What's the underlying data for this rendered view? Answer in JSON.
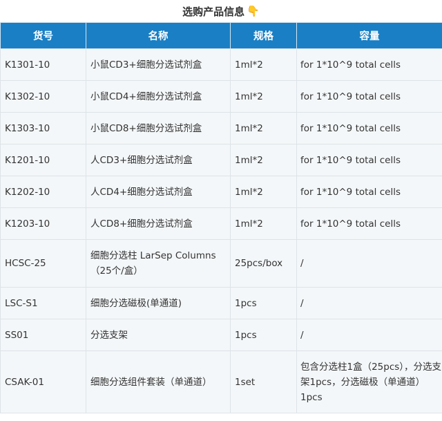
{
  "header": {
    "title": "选购产品信息",
    "icon": "pointing-hand-icon",
    "icon_color": "#f0b400"
  },
  "table": {
    "header_bg": "#1a7fc4",
    "columns": [
      "货号",
      "名称",
      "规格",
      "容量"
    ],
    "rows": [
      {
        "sku": "K1301-10",
        "name": "小鼠CD3+细胞分选试剂盒",
        "spec": "1ml*2",
        "capacity": "for 1*10^9 total cells"
      },
      {
        "sku": "K1302-10",
        "name": "小鼠CD4+细胞分选试剂盒",
        "spec": "1ml*2",
        "capacity": "for 1*10^9 total cells"
      },
      {
        "sku": "K1303-10",
        "name": "小鼠CD8+细胞分选试剂盒",
        "spec": "1ml*2",
        "capacity": "for 1*10^9 total cells"
      },
      {
        "sku": "K1201-10",
        "name": "人CD3+细胞分选试剂盒",
        "spec": "1ml*2",
        "capacity": "for 1*10^9 total cells"
      },
      {
        "sku": "K1202-10",
        "name": "人CD4+细胞分选试剂盒",
        "spec": "1ml*2",
        "capacity": "for 1*10^9 total cells"
      },
      {
        "sku": "K1203-10",
        "name": "人CD8+细胞分选试剂盒",
        "spec": "1ml*2",
        "capacity": "for 1*10^9 total cells"
      },
      {
        "sku": "HCSC-25",
        "name": "细胞分选柱 LarSep Columns（25个/盒）",
        "spec": "25pcs/box",
        "capacity": "/"
      },
      {
        "sku": "LSC-S1",
        "name": "细胞分选磁极(单通道)",
        "spec": "1pcs",
        "capacity": "/"
      },
      {
        "sku": "SS01",
        "name": "分选支架",
        "spec": "1pcs",
        "capacity": "/"
      },
      {
        "sku": "CSAK-01",
        "name": "细胞分选组件套装（单通道）",
        "spec": "1set",
        "capacity": "包含分选柱1盒（25pcs），分选支架1pcs，分选磁极（单通道）1pcs"
      }
    ]
  }
}
